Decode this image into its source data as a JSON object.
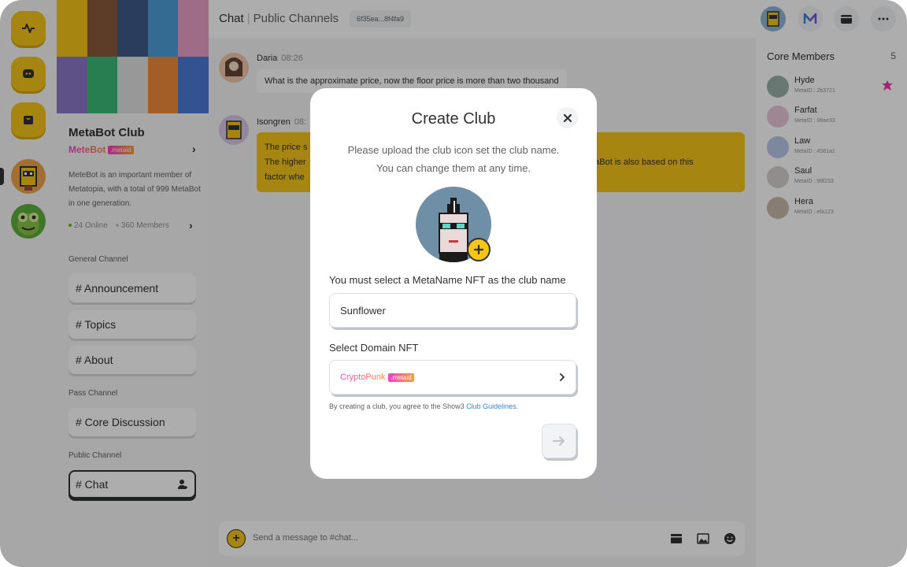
{
  "rail": {
    "items": [
      {
        "icon": "activity-icon"
      },
      {
        "icon": "chat-bubble-icon"
      },
      {
        "icon": "shopping-bag-icon"
      },
      {
        "icon": "metabot-club-avatar"
      },
      {
        "icon": "frog-club-avatar"
      }
    ]
  },
  "sidebar": {
    "club_name": "MetaBot Club",
    "owner": "MeteBot",
    "owner_badge": ".metaid",
    "description": "MeteBot is an important member of  Metatopia, with a total of 999 MetaBot in one generation.",
    "online": "24 Online",
    "members": "360 Members",
    "sections": [
      {
        "title": "General Channel",
        "channels": [
          "# Announcement",
          "# Topics",
          "# About"
        ]
      },
      {
        "title": "Pass Channel",
        "channels": [
          "# Core Discussion"
        ]
      },
      {
        "title": "Public Channel",
        "channels": [
          "# Chat"
        ]
      }
    ]
  },
  "header": {
    "title": "Chat",
    "subtitle": "Public Channels",
    "channel_id": "6f35ea...8f4fa9"
  },
  "messages": [
    {
      "name": "Daria",
      "time": "08:26",
      "text": "What is the approximate price, now the floor price is more than two thousand"
    },
    {
      "name": "Isongren",
      "time": "08:",
      "lines": [
        "The price s",
        "The higher",
        "factor whe"
      ],
      "tail": "etaBot is also based on this"
    }
  ],
  "composer": {
    "placeholder": "Send a message to #chat..."
  },
  "core_members": {
    "title": "Core Members",
    "count": "5",
    "members": [
      {
        "name": "Hyde",
        "metaid": "MetaID : 2b3721"
      },
      {
        "name": "Farfat",
        "metaid": "MetaID : 98ae33"
      },
      {
        "name": "Law",
        "metaid": "MetaID : 4581a1"
      },
      {
        "name": "Saul",
        "metaid": "MetaID : 99f233"
      },
      {
        "name": "Hera",
        "metaid": "MetaID : efa123"
      }
    ]
  },
  "modal": {
    "title": "Create Club",
    "desc_line1": "Please upload the club icon set the club name.",
    "desc_line2": "You can change them at any time.",
    "name_label": "You must select a MetaName NFT as the club name",
    "name_value": "Sunflower",
    "domain_label": "Select Domain NFT",
    "domain_value": "CryptoPunk",
    "domain_badge": ".metaid",
    "terms_prefix": "By creating a club, you agree to the Show3",
    "terms_link": "Club Guidelines",
    "terms_suffix": "."
  },
  "colors": {
    "accent_yellow": "#f5c518",
    "brand_gradient_start": "#ff3ccb",
    "brand_gradient_end": "#ff8a2d",
    "link_blue": "#3b82d6",
    "online_green": "#52c41a"
  }
}
